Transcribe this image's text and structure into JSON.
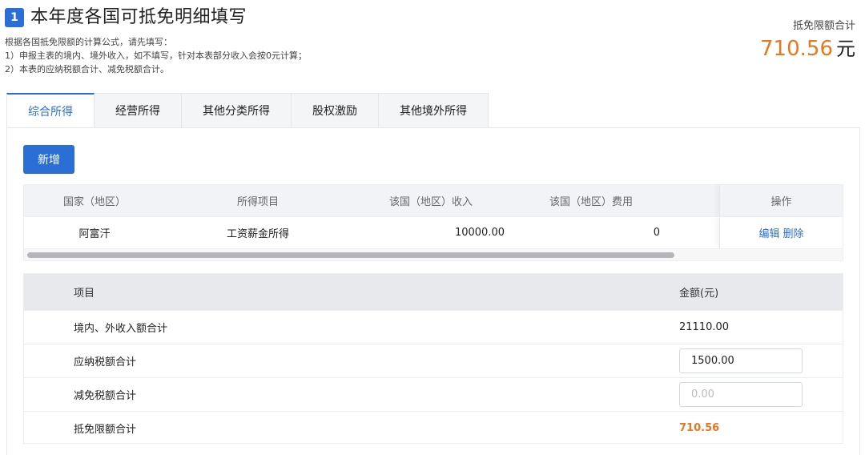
{
  "header": {
    "step": "1",
    "title": "本年度各国可抵免明细填写",
    "intro": [
      "根据各国抵免限额的计算公式，请先填写：",
      "1）申报主表的境内、境外收入，如不填写，针对本表部分收入会按0元计算；",
      "2）本表的应纳税额合计、减免税额合计。"
    ]
  },
  "total": {
    "label": "抵免限额合计",
    "value": "710.56",
    "unit": "元"
  },
  "tabs": [
    {
      "label": "综合所得",
      "active": true
    },
    {
      "label": "经营所得",
      "active": false
    },
    {
      "label": "其他分类所得",
      "active": false
    },
    {
      "label": "股权激励",
      "active": false
    },
    {
      "label": "其他境外所得",
      "active": false
    }
  ],
  "add_button": "新增",
  "grid": {
    "columns": [
      "国家（地区）",
      "所得项目",
      "该国（地区）收入",
      "该国（地区）费用",
      "操作"
    ],
    "rows": [
      {
        "country": "阿富汗",
        "item": "工资薪金所得",
        "income": "10000.00",
        "expense": "0",
        "edit": "编辑",
        "delete": "删除"
      }
    ]
  },
  "summary": {
    "col_item": "项目",
    "col_amount": "金额(元)",
    "rows": [
      {
        "label": "境内、外收入额合计",
        "value": "21110.00"
      },
      {
        "label": "应纳税额合计",
        "input_value": "1500.00"
      },
      {
        "label": "减免税额合计",
        "placeholder": "0.00"
      },
      {
        "label": "抵免限额合计",
        "value": "710.56"
      }
    ]
  },
  "colors": {
    "primary": "#2b6fd6",
    "accent": "#e8771e"
  }
}
